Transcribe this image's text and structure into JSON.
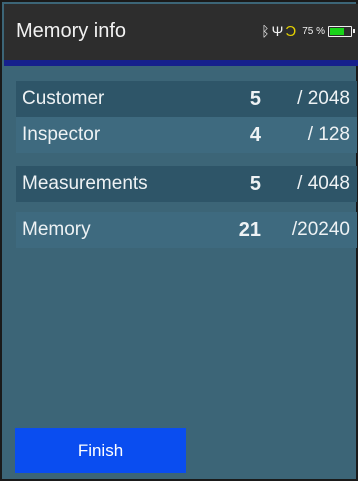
{
  "header": {
    "title": "Memory info",
    "battery_percent": "75 %",
    "battery_level": 0.75,
    "icons": [
      "bluetooth-icon",
      "usb-icon",
      "charging-plug-icon",
      "battery-icon"
    ],
    "colors": {
      "header_bg": "#2d2d2d",
      "accent_bar": "#16208c",
      "plug": "#e6d200",
      "battery_fill": "#19d419"
    }
  },
  "memory": {
    "rows": [
      {
        "label": "Customer",
        "used": "5",
        "total": "/ 2048"
      },
      {
        "label": "Inspector",
        "used": "4",
        "total": "/ 128"
      },
      {
        "label": "Measurements",
        "used": "5",
        "total": "/ 4048"
      },
      {
        "label": "Memory",
        "used": "21",
        "total": "/20240"
      }
    ]
  },
  "actions": {
    "finish_label": "Finish",
    "finish_color": "#0a4df0"
  },
  "colors": {
    "background": "#3c6577",
    "row_dark": "#2e5568",
    "row_light": "#3e6a7f"
  }
}
